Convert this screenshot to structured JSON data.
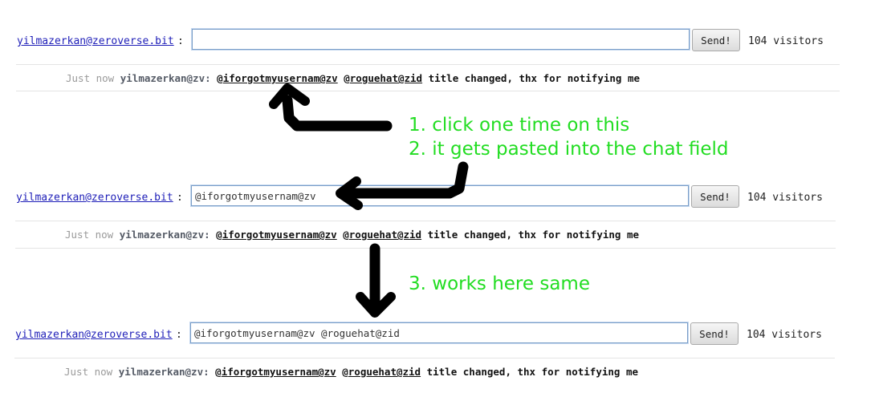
{
  "rows": [
    {
      "user": "yilmazerkan@zeroverse.bit",
      "colon": ":",
      "input_value": "",
      "send_label": "Send!",
      "visitors": "104 visitors"
    },
    {
      "user": "yilmazerkan@zeroverse.bit",
      "colon": ":",
      "input_value": "@iforgotmyusernam@zv",
      "send_label": "Send!",
      "visitors": "104 visitors"
    },
    {
      "user": "yilmazerkan@zeroverse.bit",
      "colon": ":",
      "input_value": "@iforgotmyusernam@zv @roguehat@zid",
      "send_label": "Send!",
      "visitors": "104 visitors"
    }
  ],
  "message": {
    "time": "Just now",
    "from": "yilmazerkan@zv:",
    "mention1_at": "@",
    "mention1_name": "iforgotmyusernam@zv",
    "mention2_at": "@",
    "mention2_name": "roguehat@zid",
    "text": "title changed, thx for notifying me"
  },
  "annotations": {
    "step1": "1. click one time on this",
    "step2": "2. it gets pasted into the chat field",
    "step3": "3. works here same"
  },
  "colors": {
    "annotation": "#22dd22",
    "arrow": "#000000",
    "link": "#1f1fb8"
  }
}
